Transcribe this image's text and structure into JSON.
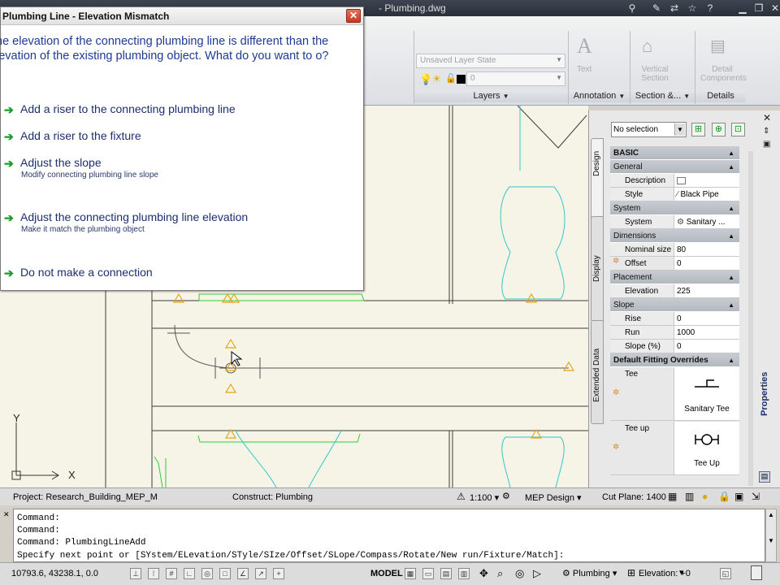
{
  "app": {
    "document_title": "Plumbing.dwg"
  },
  "ribbon": {
    "layer_state": "Unsaved Layer State",
    "layer_value": "0",
    "panels": [
      "Layers",
      "Annotation",
      "Section &...",
      "Details"
    ],
    "ghost_buttons": [
      "Text",
      "Vertical Section",
      "Detail Components"
    ]
  },
  "dialog": {
    "title": "Plumbing Line - Elevation Mismatch",
    "message": "he elevation of the connecting plumbing line is different than the levation of the existing plumbing object. What do you want to o?",
    "options": [
      {
        "label": "Add a riser to the connecting plumbing line",
        "sub": ""
      },
      {
        "label": "Add a riser to the fixture",
        "sub": ""
      },
      {
        "label": "Adjust the slope",
        "sub": "Modify connecting plumbing line slope"
      },
      {
        "label": "Adjust the connecting plumbing line elevation",
        "sub": "Make it match the plumbing object"
      },
      {
        "label": "Do not make a connection",
        "sub": ""
      }
    ]
  },
  "properties": {
    "selection": "No selection",
    "tabs": [
      "Design",
      "Display",
      "Extended Data"
    ],
    "palette_title": "Properties",
    "sections": {
      "basic": "BASIC",
      "general": "General",
      "system": "System",
      "dimensions": "Dimensions",
      "placement": "Placement",
      "slope": "Slope",
      "fitting": "Default Fitting Overrides"
    },
    "rows": {
      "description": {
        "name": "Description",
        "value": ""
      },
      "style": {
        "name": "Style",
        "value": "Black Pipe"
      },
      "system": {
        "name": "System",
        "value": "Sanitary ..."
      },
      "nominal_size": {
        "name": "Nominal size",
        "value": "80"
      },
      "offset": {
        "name": "Offset",
        "value": "0"
      },
      "elevation": {
        "name": "Elevation",
        "value": "225"
      },
      "rise": {
        "name": "Rise",
        "value": "0"
      },
      "run": {
        "name": "Run",
        "value": "1000"
      },
      "slope_pct": {
        "name": "Slope (%)",
        "value": "0"
      },
      "tee": {
        "name": "Tee",
        "value": "Sanitary Tee"
      },
      "tee_up": {
        "name": "Tee up",
        "value": "Tee Up"
      }
    }
  },
  "drawing": {
    "ucs_x": "X",
    "ucs_y": "Y"
  },
  "status": {
    "project": "Project: Research_Building_MEP_M",
    "construct": "Construct: Plumbing",
    "scale": "1:100",
    "workspace": "MEP Design",
    "cut_plane": "Cut Plane:  1400",
    "coords": "10793.6, 43238.1, 0.0",
    "model": "MODEL",
    "plumbing": "Plumbing",
    "elevation": "Elevation: +0"
  },
  "command": {
    "lines": [
      "Command:",
      "Command:",
      "Command: PlumbingLineAdd",
      "Specify next point or [SYstem/ELevation/STyle/SIze/Offset/SLope/Compass/Rotate/New run/Fixture/Match]:"
    ]
  },
  "colors": {
    "cyan_fixture": "#34c7c9",
    "green_fixture": "#2ecb3c",
    "warning": "#e6a317",
    "dialog_text": "#1f3a93"
  }
}
